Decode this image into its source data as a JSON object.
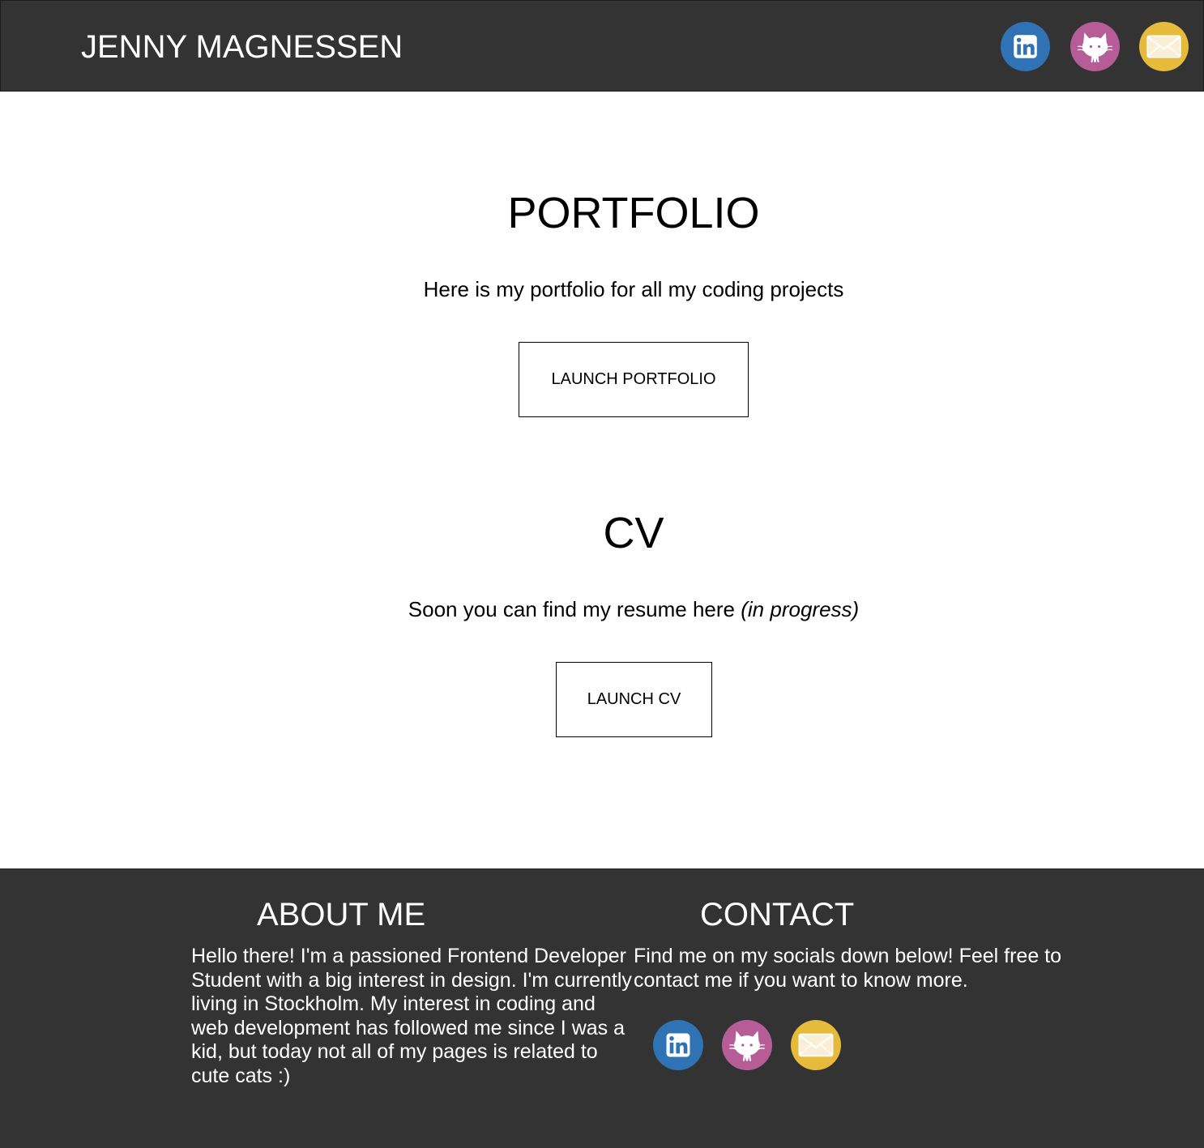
{
  "header": {
    "brand": "JENNY MAGNESSEN",
    "socials": [
      {
        "name": "linkedin",
        "icon": "linkedin-icon",
        "color": "#2f73b4"
      },
      {
        "name": "github",
        "icon": "github-cat-icon",
        "color": "#b65d97"
      },
      {
        "name": "email",
        "icon": "envelope-icon",
        "color": "#e6bb3c"
      }
    ]
  },
  "main": {
    "portfolio": {
      "title": "PORTFOLIO",
      "text": "Here is my portfolio for all my coding projects",
      "button_label": "LAUNCH PORTFOLIO"
    },
    "cv": {
      "title": "CV",
      "text": "Soon you can find my resume here ",
      "text_emphasis": "(in progress)",
      "button_label": "LAUNCH CV"
    }
  },
  "footer": {
    "about": {
      "title": "ABOUT ME",
      "text": "Hello there! I'm a passioned Frontend Developer Student with a big interest in design. I'm currently living in Stockholm. My interest in coding and web development has followed me since I was a kid, but today not all of my pages is related to cute cats :)"
    },
    "contact": {
      "title": "CONTACT",
      "text": "Find me on my socials down below! Feel free to contact me if you want to know more."
    }
  },
  "colors": {
    "bar_background": "#333333",
    "linkedin": "#2f73b4",
    "github": "#b65d97",
    "email": "#e6bb3c"
  }
}
